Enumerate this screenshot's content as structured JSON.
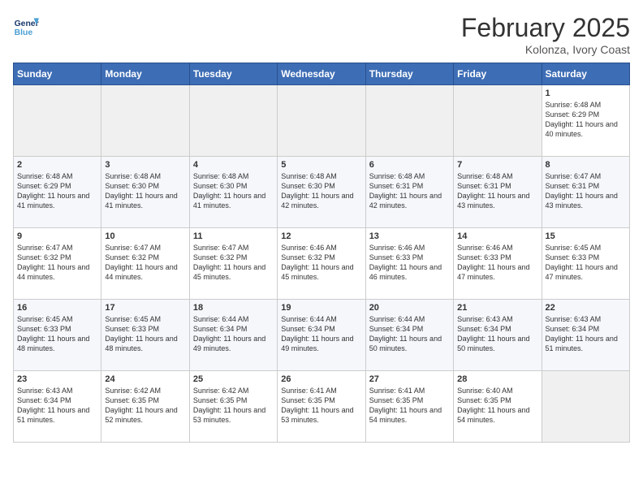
{
  "header": {
    "logo_line1": "General",
    "logo_line2": "Blue",
    "month": "February 2025",
    "location": "Kolonza, Ivory Coast"
  },
  "days_of_week": [
    "Sunday",
    "Monday",
    "Tuesday",
    "Wednesday",
    "Thursday",
    "Friday",
    "Saturday"
  ],
  "weeks": [
    [
      {
        "day": "",
        "info": ""
      },
      {
        "day": "",
        "info": ""
      },
      {
        "day": "",
        "info": ""
      },
      {
        "day": "",
        "info": ""
      },
      {
        "day": "",
        "info": ""
      },
      {
        "day": "",
        "info": ""
      },
      {
        "day": "1",
        "info": "Sunrise: 6:48 AM\nSunset: 6:29 PM\nDaylight: 11 hours and 40 minutes."
      }
    ],
    [
      {
        "day": "2",
        "info": "Sunrise: 6:48 AM\nSunset: 6:29 PM\nDaylight: 11 hours and 41 minutes."
      },
      {
        "day": "3",
        "info": "Sunrise: 6:48 AM\nSunset: 6:30 PM\nDaylight: 11 hours and 41 minutes."
      },
      {
        "day": "4",
        "info": "Sunrise: 6:48 AM\nSunset: 6:30 PM\nDaylight: 11 hours and 41 minutes."
      },
      {
        "day": "5",
        "info": "Sunrise: 6:48 AM\nSunset: 6:30 PM\nDaylight: 11 hours and 42 minutes."
      },
      {
        "day": "6",
        "info": "Sunrise: 6:48 AM\nSunset: 6:31 PM\nDaylight: 11 hours and 42 minutes."
      },
      {
        "day": "7",
        "info": "Sunrise: 6:48 AM\nSunset: 6:31 PM\nDaylight: 11 hours and 43 minutes."
      },
      {
        "day": "8",
        "info": "Sunrise: 6:47 AM\nSunset: 6:31 PM\nDaylight: 11 hours and 43 minutes."
      }
    ],
    [
      {
        "day": "9",
        "info": "Sunrise: 6:47 AM\nSunset: 6:32 PM\nDaylight: 11 hours and 44 minutes."
      },
      {
        "day": "10",
        "info": "Sunrise: 6:47 AM\nSunset: 6:32 PM\nDaylight: 11 hours and 44 minutes."
      },
      {
        "day": "11",
        "info": "Sunrise: 6:47 AM\nSunset: 6:32 PM\nDaylight: 11 hours and 45 minutes."
      },
      {
        "day": "12",
        "info": "Sunrise: 6:46 AM\nSunset: 6:32 PM\nDaylight: 11 hours and 45 minutes."
      },
      {
        "day": "13",
        "info": "Sunrise: 6:46 AM\nSunset: 6:33 PM\nDaylight: 11 hours and 46 minutes."
      },
      {
        "day": "14",
        "info": "Sunrise: 6:46 AM\nSunset: 6:33 PM\nDaylight: 11 hours and 47 minutes."
      },
      {
        "day": "15",
        "info": "Sunrise: 6:45 AM\nSunset: 6:33 PM\nDaylight: 11 hours and 47 minutes."
      }
    ],
    [
      {
        "day": "16",
        "info": "Sunrise: 6:45 AM\nSunset: 6:33 PM\nDaylight: 11 hours and 48 minutes."
      },
      {
        "day": "17",
        "info": "Sunrise: 6:45 AM\nSunset: 6:33 PM\nDaylight: 11 hours and 48 minutes."
      },
      {
        "day": "18",
        "info": "Sunrise: 6:44 AM\nSunset: 6:34 PM\nDaylight: 11 hours and 49 minutes."
      },
      {
        "day": "19",
        "info": "Sunrise: 6:44 AM\nSunset: 6:34 PM\nDaylight: 11 hours and 49 minutes."
      },
      {
        "day": "20",
        "info": "Sunrise: 6:44 AM\nSunset: 6:34 PM\nDaylight: 11 hours and 50 minutes."
      },
      {
        "day": "21",
        "info": "Sunrise: 6:43 AM\nSunset: 6:34 PM\nDaylight: 11 hours and 50 minutes."
      },
      {
        "day": "22",
        "info": "Sunrise: 6:43 AM\nSunset: 6:34 PM\nDaylight: 11 hours and 51 minutes."
      }
    ],
    [
      {
        "day": "23",
        "info": "Sunrise: 6:43 AM\nSunset: 6:34 PM\nDaylight: 11 hours and 51 minutes."
      },
      {
        "day": "24",
        "info": "Sunrise: 6:42 AM\nSunset: 6:35 PM\nDaylight: 11 hours and 52 minutes."
      },
      {
        "day": "25",
        "info": "Sunrise: 6:42 AM\nSunset: 6:35 PM\nDaylight: 11 hours and 53 minutes."
      },
      {
        "day": "26",
        "info": "Sunrise: 6:41 AM\nSunset: 6:35 PM\nDaylight: 11 hours and 53 minutes."
      },
      {
        "day": "27",
        "info": "Sunrise: 6:41 AM\nSunset: 6:35 PM\nDaylight: 11 hours and 54 minutes."
      },
      {
        "day": "28",
        "info": "Sunrise: 6:40 AM\nSunset: 6:35 PM\nDaylight: 11 hours and 54 minutes."
      },
      {
        "day": "",
        "info": ""
      }
    ]
  ]
}
